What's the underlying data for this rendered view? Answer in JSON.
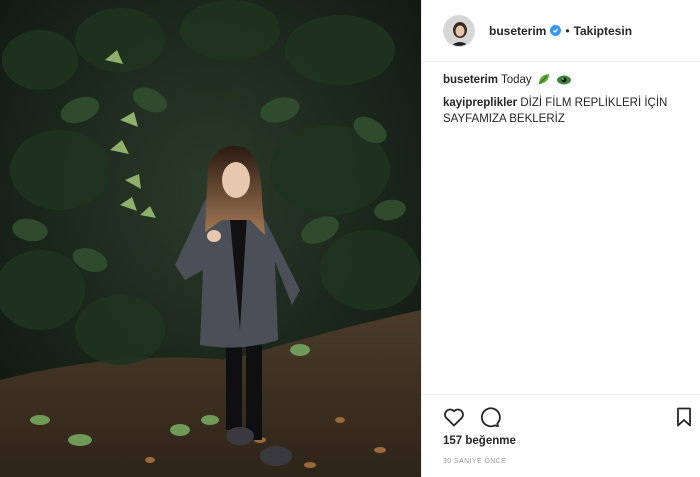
{
  "post": {
    "username": "buseterim",
    "follow_status": "Takiptesin",
    "separator": "•",
    "caption_text": "Today",
    "comment": {
      "username": "kayipreplikler",
      "text": "DİZİ FİLM REPLİKLERİ İÇİN SAYFAMIZA BEKLERİZ"
    },
    "likes": "157 beğenme",
    "timestamp": "30 SANİYE ÖNCE"
  },
  "icons": {
    "verified": "verified-badge-icon",
    "like": "heart-icon",
    "comment": "comment-icon",
    "save": "bookmark-icon",
    "emoji_1": "leaf-emoji-icon",
    "emoji_2": "eye-emoji-icon"
  },
  "colors": {
    "verified_blue": "#3897f0",
    "text": "#262626",
    "muted": "#999999",
    "border": "#efefef"
  }
}
